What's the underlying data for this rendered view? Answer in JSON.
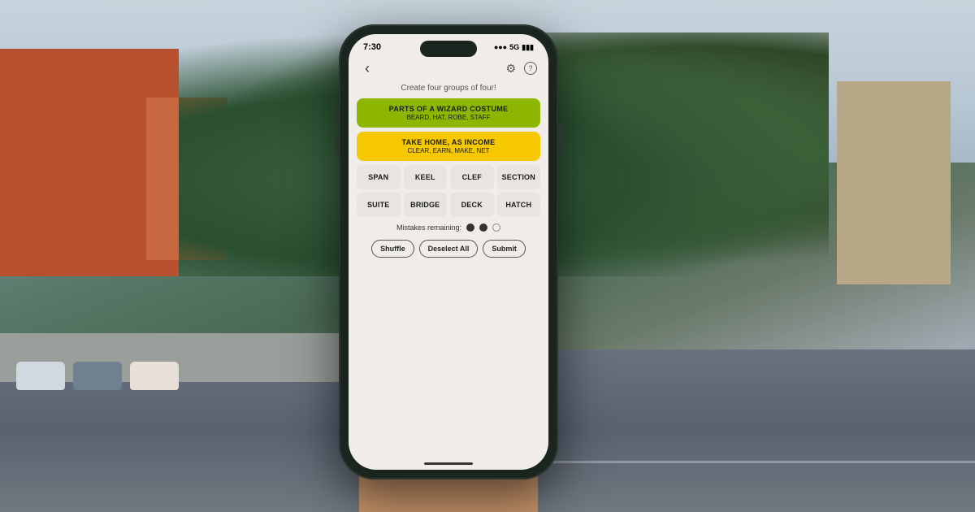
{
  "background": {
    "description": "street scene background"
  },
  "phone": {
    "status_bar": {
      "time": "7:30",
      "signal": "●●●",
      "network": "5G",
      "battery": "●●●"
    },
    "app": {
      "instruction": "Create four groups of four!",
      "completed_groups": [
        {
          "id": "green",
          "title": "PARTS OF A WIZARD COSTUME",
          "items": "BEARD, HAT, ROBE, STAFF",
          "color": "green"
        },
        {
          "id": "yellow",
          "title": "TAKE HOME, AS INCOME",
          "items": "CLEAR, EARN, MAKE, NET",
          "color": "yellow"
        }
      ],
      "word_tiles": [
        {
          "word": "SPAN"
        },
        {
          "word": "KEEL"
        },
        {
          "word": "CLEF"
        },
        {
          "word": "SECTION"
        },
        {
          "word": "SUITE"
        },
        {
          "word": "BRIDGE"
        },
        {
          "word": "DECK"
        },
        {
          "word": "HATCH"
        }
      ],
      "mistakes": {
        "label": "Mistakes remaining:",
        "filled": 2,
        "empty": 1,
        "total": 3
      },
      "buttons": {
        "shuffle": "Shuffle",
        "deselect_all": "Deselect All",
        "submit": "Submit"
      },
      "nav": {
        "back_icon": "‹",
        "gear_icon": "⚙",
        "help_icon": "?"
      }
    }
  }
}
